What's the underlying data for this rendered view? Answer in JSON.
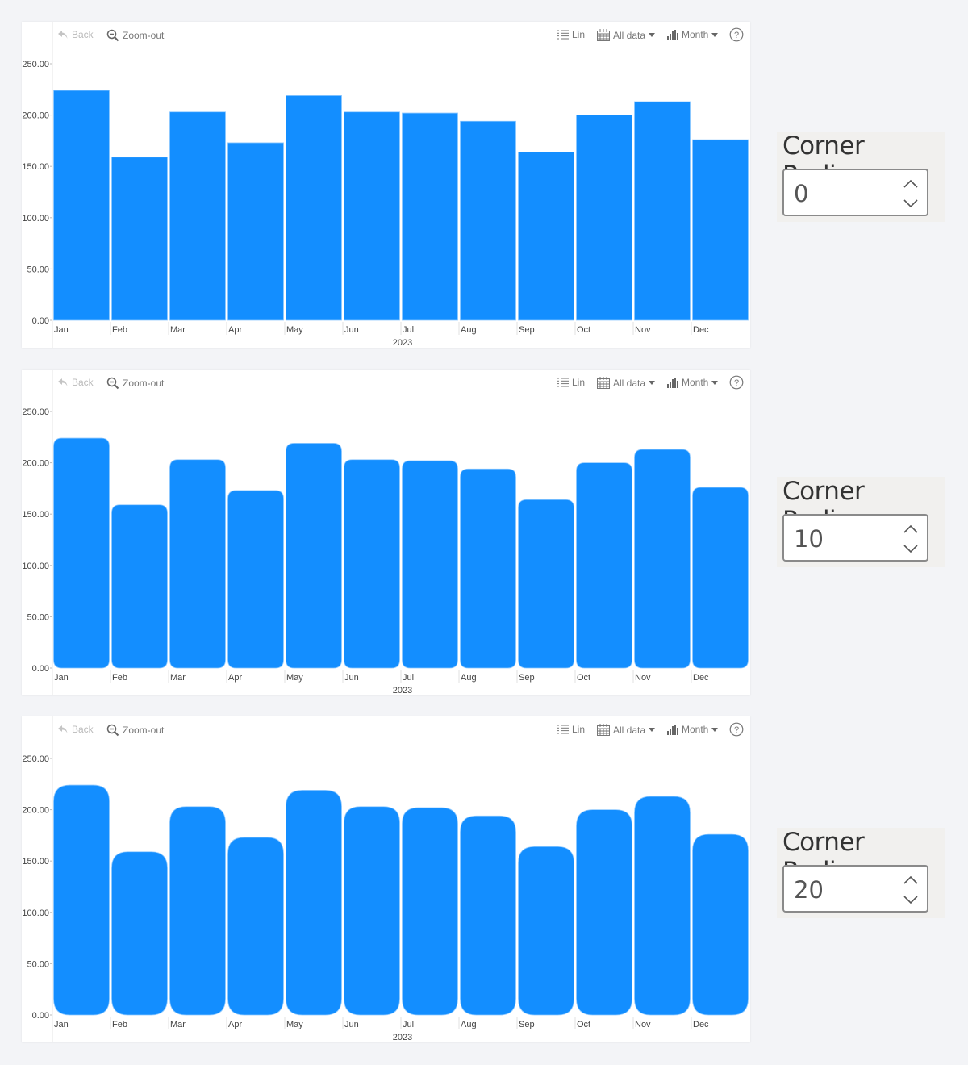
{
  "toolbar": {
    "back_label": "Back",
    "zoomout_label": "Zoom-out",
    "scale_label": "Lin",
    "range_label": "All data",
    "period_label": "Month"
  },
  "colors": {
    "bar": "#138eff",
    "background": "#f3f4f7",
    "panel": "#ffffff"
  },
  "controls": [
    {
      "label": "Corner Radius",
      "value": "0"
    },
    {
      "label": "Corner Radius",
      "value": "10"
    },
    {
      "label": "Corner Radius",
      "value": "20"
    }
  ],
  "chart_data": [
    {
      "type": "bar",
      "title": "",
      "corner_radius": 0,
      "categories": [
        "Jan",
        "Feb",
        "Mar",
        "Apr",
        "May",
        "Jun",
        "Jul",
        "Aug",
        "Sep",
        "Oct",
        "Nov",
        "Dec"
      ],
      "values": [
        224,
        159,
        203,
        173,
        219,
        203,
        202,
        194,
        164,
        200,
        213,
        176
      ],
      "xlabel": "2023",
      "ylabel": "",
      "ylim": [
        0,
        250
      ],
      "yticks": [
        "0.00",
        "50.00",
        "100.00",
        "150.00",
        "200.00",
        "250.00"
      ],
      "grid": false,
      "legend": "none"
    },
    {
      "type": "bar",
      "title": "",
      "corner_radius": 10,
      "categories": [
        "Jan",
        "Feb",
        "Mar",
        "Apr",
        "May",
        "Jun",
        "Jul",
        "Aug",
        "Sep",
        "Oct",
        "Nov",
        "Dec"
      ],
      "values": [
        224,
        159,
        203,
        173,
        219,
        203,
        202,
        194,
        164,
        200,
        213,
        176
      ],
      "xlabel": "2023",
      "ylabel": "",
      "ylim": [
        0,
        250
      ],
      "yticks": [
        "0.00",
        "50.00",
        "100.00",
        "150.00",
        "200.00",
        "250.00"
      ],
      "grid": false,
      "legend": "none"
    },
    {
      "type": "bar",
      "title": "",
      "corner_radius": 20,
      "categories": [
        "Jan",
        "Feb",
        "Mar",
        "Apr",
        "May",
        "Jun",
        "Jul",
        "Aug",
        "Sep",
        "Oct",
        "Nov",
        "Dec"
      ],
      "values": [
        224,
        159,
        203,
        173,
        219,
        203,
        202,
        194,
        164,
        200,
        213,
        176
      ],
      "xlabel": "2023",
      "ylabel": "",
      "ylim": [
        0,
        250
      ],
      "yticks": [
        "0.00",
        "50.00",
        "100.00",
        "150.00",
        "200.00",
        "250.00"
      ],
      "grid": false,
      "legend": "none"
    }
  ]
}
